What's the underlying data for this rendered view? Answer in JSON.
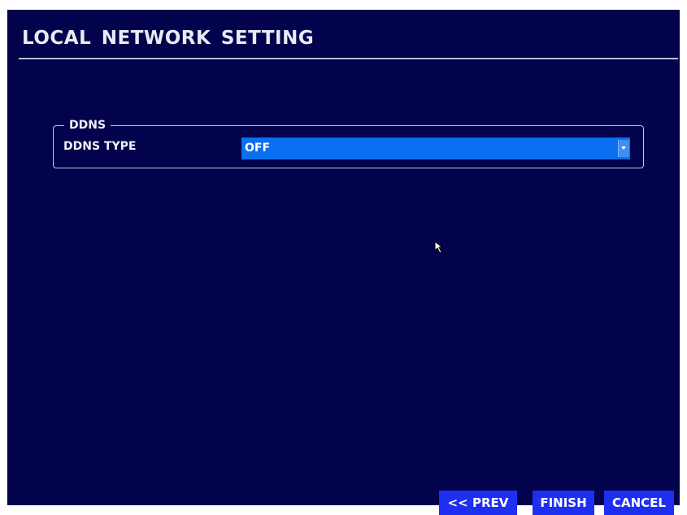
{
  "header": {
    "title": "LOCAL NETWORK SETTING"
  },
  "ddns_group": {
    "legend": "DDNS",
    "fields": {
      "ddns_type": {
        "label": "DDNS TYPE",
        "selected": "OFF"
      }
    }
  },
  "footer": {
    "prev_label": "<< PREV",
    "finish_label": "FINISH",
    "cancel_label": "CANCEL"
  },
  "icons": {
    "dropdown": "chevron-down-icon",
    "cursor": "mouse-cursor-icon"
  },
  "colors": {
    "background": "#02034c",
    "text": "#eef0f6",
    "select_fill": "#0a6ff0",
    "button_fill": "#1e2ff2",
    "divider": "#b8bccb"
  }
}
